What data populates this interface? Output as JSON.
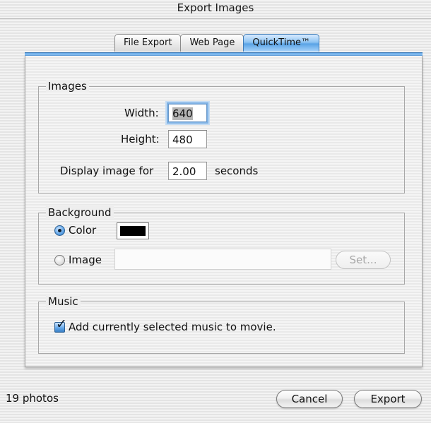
{
  "window": {
    "title": "Export Images"
  },
  "tabs": [
    {
      "label": "File Export",
      "selected": false
    },
    {
      "label": "Web Page",
      "selected": false
    },
    {
      "label": "QuickTime™",
      "selected": true
    }
  ],
  "images_group": {
    "label": "Images",
    "width_label": "Width:",
    "width_value": "640",
    "height_label": "Height:",
    "height_value": "480",
    "display_label": "Display image for",
    "display_value": "2.00",
    "display_unit": "seconds"
  },
  "background_group": {
    "label": "Background",
    "color_option": {
      "label": "Color",
      "selected": true
    },
    "color_value": "#000000",
    "image_option": {
      "label": "Image",
      "selected": false
    },
    "image_path": "",
    "set_button": "Set..."
  },
  "music_group": {
    "label": "Music",
    "add_music_checkbox": {
      "label": "Add currently selected music to movie.",
      "checked": true
    }
  },
  "footer": {
    "photo_count": "19 photos",
    "cancel_button": "Cancel",
    "export_button": "Export"
  },
  "colors": {
    "accent_blue": "#5aa3e6",
    "background_stripe": "#e4e4e4"
  }
}
